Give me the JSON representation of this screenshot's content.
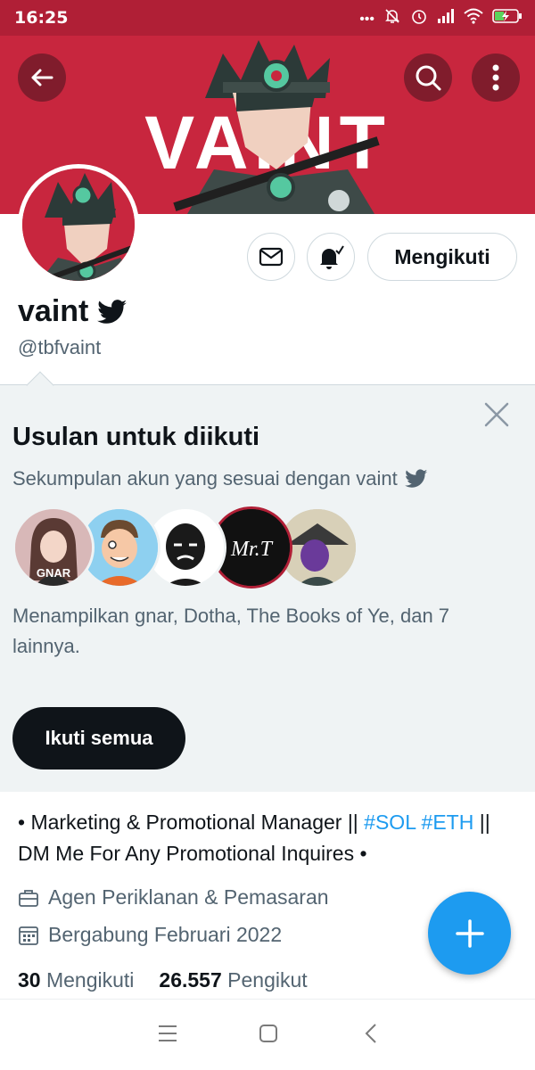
{
  "status_bar": {
    "time": "16:25",
    "icons": [
      "more-dots-icon",
      "bell-off-icon",
      "alarm-icon",
      "signal-icon",
      "wifi-icon",
      "battery-charging-icon"
    ]
  },
  "banner": {
    "text": "VAINT",
    "background_color": "#c8263e"
  },
  "header_buttons": {
    "back": "back-arrow-icon",
    "search": "search-icon",
    "more": "more-vertical-icon"
  },
  "profile": {
    "name": "vaint",
    "handle": "@tbfvaint",
    "following_button": "Mengikuti",
    "bio_parts": [
      "• Marketing & Promotional Manager ||  ",
      "#SOL",
      " ",
      "#ETH",
      " || DM Me For Any Promotional Inquires •"
    ],
    "category": "Agen Periklanan & Pemasaran",
    "joined": "Bergabung Februari 2022",
    "following_count": "30",
    "following_label": "Mengikuti",
    "followers_count": "26.557",
    "followers_label": "Pengikut"
  },
  "suggestions": {
    "title": "Usulan untuk diikuti",
    "subtitle": "Sekumpulan akun yang sesuai dengan vaint",
    "description": "Menampilkan gnar, Dotha, The Books of Ye, dan 7 lainnya.",
    "follow_all": "Ikuti semua",
    "avatar_labels": [
      "GNAR",
      "Mr.T"
    ]
  },
  "colors": {
    "accent": "#1d9bf0",
    "text": "#0f1419",
    "muted": "#536471",
    "banner": "#c8263e",
    "card_bg": "#eff3f4"
  }
}
